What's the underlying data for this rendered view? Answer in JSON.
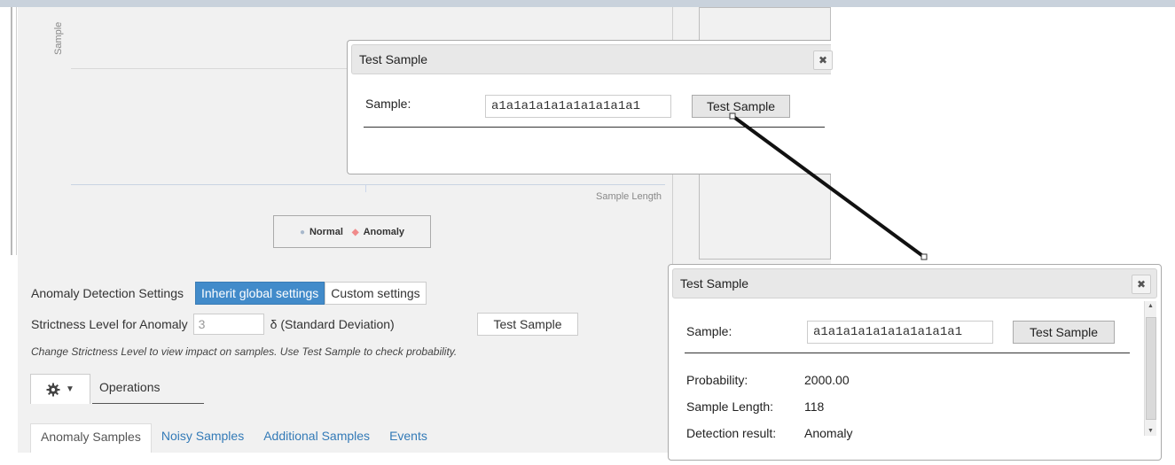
{
  "chart": {
    "ylabel": "Sample",
    "xlabel": "Sample Length",
    "legend": {
      "normal": "Normal",
      "anomaly": "Anomaly",
      "normal_color": "#a8b8cc",
      "anomaly_color": "#f08a8a"
    }
  },
  "settings": {
    "label": "Anomaly Detection Settings",
    "inherit_button": "Inherit global settings",
    "custom_button": "Custom settings",
    "strictness_label": "Strictness Level for Anomaly",
    "strictness_value": "3",
    "delta_label": "δ (Standard Deviation)",
    "test_sample_button": "Test Sample",
    "hint": "Change Strictness Level to view impact on samples. Use Test Sample to check probability.",
    "accent_color": "#428bca"
  },
  "operations": {
    "gear_icon": "gear-icon",
    "label": "Operations"
  },
  "tabs": [
    {
      "label": "Anomaly Samples",
      "active": true
    },
    {
      "label": "Noisy Samples",
      "active": false
    },
    {
      "label": "Additional Samples",
      "active": false
    },
    {
      "label": "Events",
      "active": false
    }
  ],
  "dialog_small": {
    "title": "Test Sample",
    "close_icon": "close-icon",
    "sample_label": "Sample:",
    "sample_value": "a1a1a1a1a1a1a1a1a1a1",
    "button": "Test Sample"
  },
  "dialog_large": {
    "title": "Test Sample",
    "close_icon": "close-icon",
    "sample_label": "Sample:",
    "sample_value": "a1a1a1a1a1a1a1a1a1a1",
    "button": "Test Sample",
    "probability_label": "Probability:",
    "probability_value": "2000.00",
    "length_label": "Sample Length:",
    "length_value": "118",
    "result_label": "Detection result:",
    "result_value": "Anomaly"
  }
}
